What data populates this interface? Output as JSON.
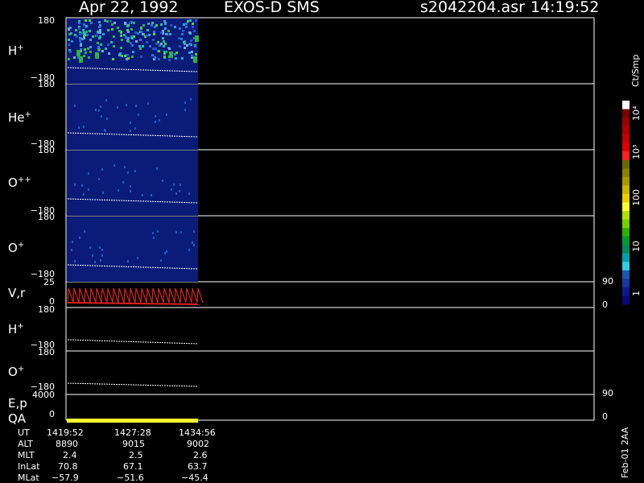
{
  "header": {
    "date": "Apr 22, 1992",
    "mission": "EXOS-D SMS",
    "file": "s2042204.asr",
    "time": "14:19:52"
  },
  "panels": [
    {
      "label": "H",
      "sup": "+",
      "top_tick": "180",
      "bottom_tick": "−180"
    },
    {
      "label": "He",
      "sup": "+",
      "top_tick": "180",
      "bottom_tick": "−180"
    },
    {
      "label": "O",
      "sup": "++",
      "top_tick": "180",
      "bottom_tick": "−180"
    },
    {
      "label": "O",
      "sup": "+",
      "top_tick": "180",
      "bottom_tick": "−180"
    },
    {
      "label": "V,r",
      "sup": "",
      "top_tick": "25",
      "bottom_tick": "0",
      "right_top": "90",
      "right_bottom": "0"
    },
    {
      "label": "H",
      "sup": "+",
      "top_tick": "180",
      "bottom_tick": "−180"
    },
    {
      "label": "O",
      "sup": "+",
      "top_tick": "180",
      "bottom_tick": "−180"
    },
    {
      "label": "E,p",
      "sup": "",
      "top_tick": "4000",
      "bottom_tick": "0",
      "right_top": "90",
      "right_bottom": "0"
    }
  ],
  "qa_label": "QA",
  "colorbar": {
    "unit": "Ct/Smp",
    "tick_labels": [
      "10⁴",
      "10³",
      "100",
      "10",
      "1"
    ],
    "colors": [
      "#ffffff",
      "#7a0000",
      "#9a0000",
      "#b00000",
      "#c80000",
      "#e00000",
      "#ff2020",
      "#6e6600",
      "#8a7f00",
      "#a89a00",
      "#c8b600",
      "#e6d000",
      "#ffff33",
      "#b0e000",
      "#78d000",
      "#30b000",
      "#009a30",
      "#008a5a",
      "#00a0b0",
      "#30d0e0",
      "#1858b0",
      "#1838a0",
      "#101890",
      "#080878"
    ]
  },
  "ephemeris": {
    "rows": [
      {
        "label": "UT",
        "values": [
          "1419:52",
          "1427:28",
          "1434:56"
        ]
      },
      {
        "label": "ALT",
        "values": [
          "8890",
          "9015",
          "9002"
        ]
      },
      {
        "label": "MLT",
        "values": [
          "2.4",
          "2.5",
          "2.6"
        ]
      },
      {
        "label": "InLat",
        "values": [
          "70.8",
          "67.1",
          "63.7"
        ]
      },
      {
        "label": "MLat",
        "values": [
          "−57.9",
          "−51.6",
          "−45.4"
        ]
      }
    ]
  },
  "footer_vertical": "Feb-01 2AA"
}
